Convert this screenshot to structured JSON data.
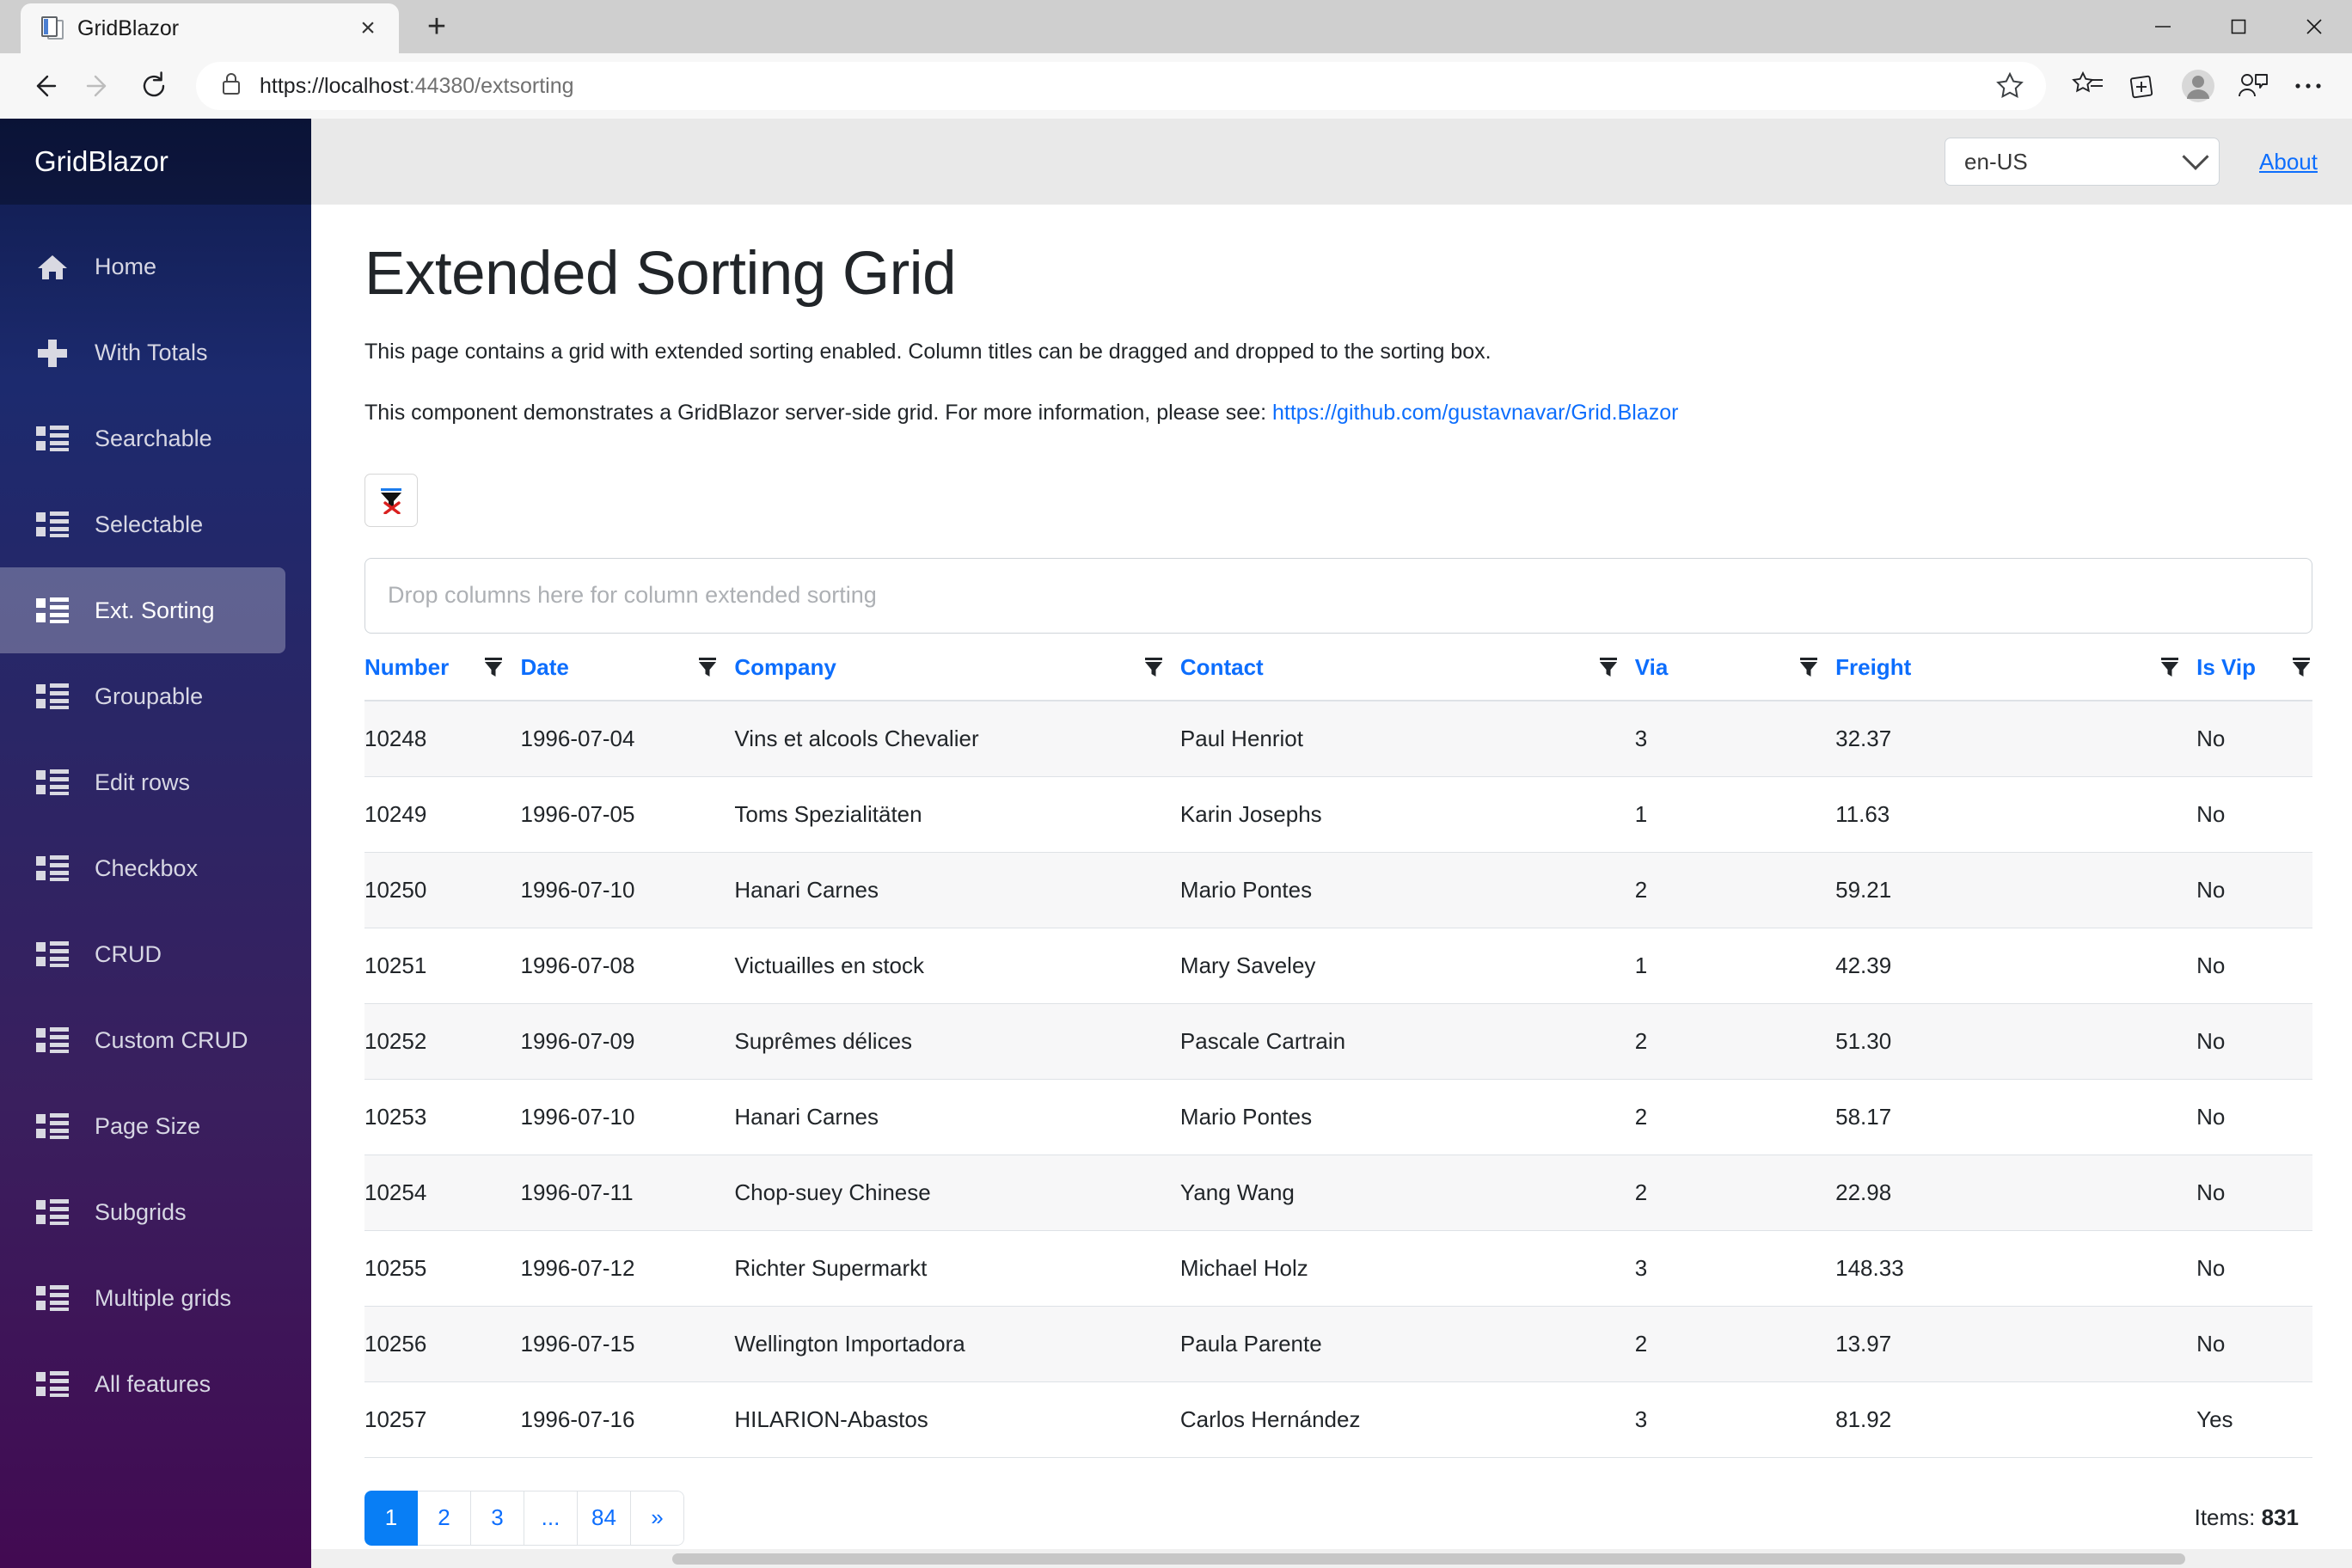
{
  "browser": {
    "tab": {
      "title": "GridBlazor",
      "favicon": "document-icon",
      "close": "×"
    },
    "new_tab": "+",
    "window_controls": {
      "minimize": "—",
      "maximize": "❐",
      "close": "✕"
    },
    "nav": {
      "back": "←",
      "forward": "→",
      "reload": "↻"
    },
    "url_scheme": "https://localhost",
    "url_rest": ":44380/extsorting",
    "url_full": "https://localhost:44380/extsorting",
    "icons": {
      "lock": "lock-icon",
      "star": "favorite-star-icon",
      "favorites": "favorites-collections-icon",
      "collections": "collections-icon",
      "profile": "profile-avatar-icon",
      "share": "share-feedback-icon",
      "settings": "more-options-icon"
    }
  },
  "sidebar": {
    "brand": "GridBlazor",
    "items": [
      {
        "label": "Home",
        "icon": "home-icon",
        "active": false
      },
      {
        "label": "With Totals",
        "icon": "plus-icon",
        "active": false
      },
      {
        "label": "Searchable",
        "icon": "list-icon",
        "active": false
      },
      {
        "label": "Selectable",
        "icon": "list-icon",
        "active": false
      },
      {
        "label": "Ext. Sorting",
        "icon": "list-icon",
        "active": true
      },
      {
        "label": "Groupable",
        "icon": "list-icon",
        "active": false
      },
      {
        "label": "Edit rows",
        "icon": "list-icon",
        "active": false
      },
      {
        "label": "Checkbox",
        "icon": "list-icon",
        "active": false
      },
      {
        "label": "CRUD",
        "icon": "list-icon",
        "active": false
      },
      {
        "label": "Custom CRUD",
        "icon": "list-icon",
        "active": false
      },
      {
        "label": "Page Size",
        "icon": "list-icon",
        "active": false
      },
      {
        "label": "Subgrids",
        "icon": "list-icon",
        "active": false
      },
      {
        "label": "Multiple grids",
        "icon": "list-icon",
        "active": false
      },
      {
        "label": "All features",
        "icon": "list-icon",
        "active": false
      }
    ]
  },
  "topbar": {
    "culture_value": "en-US",
    "culture_options": [
      "en-US"
    ],
    "about_label": "About"
  },
  "main": {
    "title": "Extended Sorting Grid",
    "description": "This page contains a grid with extended sorting enabled. Column titles can be dragged and dropped to the sorting box.",
    "description2_prefix": "This component demonstrates a GridBlazor server-side grid. For more information, please see: ",
    "description2_link": "https://github.com/gustavnavar/Grid.Blazor",
    "filter_button_icon": "clear-filter-funnel-icon",
    "dropzone_placeholder": "Drop columns here for column extended sorting"
  },
  "grid": {
    "columns": [
      {
        "label": "Number",
        "filter": "filter-funnel-icon"
      },
      {
        "label": "Date",
        "filter": "filter-funnel-icon"
      },
      {
        "label": "Company",
        "filter": "filter-funnel-icon"
      },
      {
        "label": "Contact",
        "filter": "filter-funnel-icon"
      },
      {
        "label": "Via",
        "filter": "filter-funnel-icon"
      },
      {
        "label": "Freight",
        "filter": "filter-funnel-icon"
      },
      {
        "label": "Is Vip",
        "filter": "filter-funnel-icon"
      }
    ],
    "rows": [
      {
        "number": "10248",
        "date": "1996-07-04",
        "company": "Vins et alcools Chevalier",
        "contact": "Paul Henriot",
        "via": "3",
        "freight": "32.37",
        "is_vip": "No"
      },
      {
        "number": "10249",
        "date": "1996-07-05",
        "company": "Toms Spezialitäten",
        "contact": "Karin Josephs",
        "via": "1",
        "freight": "11.63",
        "is_vip": "No"
      },
      {
        "number": "10250",
        "date": "1996-07-10",
        "company": "Hanari Carnes",
        "contact": "Mario Pontes",
        "via": "2",
        "freight": "59.21",
        "is_vip": "No"
      },
      {
        "number": "10251",
        "date": "1996-07-08",
        "company": "Victuailles en stock",
        "contact": "Mary Saveley",
        "via": "1",
        "freight": "42.39",
        "is_vip": "No"
      },
      {
        "number": "10252",
        "date": "1996-07-09",
        "company": "Suprêmes délices",
        "contact": "Pascale Cartrain",
        "via": "2",
        "freight": "51.30",
        "is_vip": "No"
      },
      {
        "number": "10253",
        "date": "1996-07-10",
        "company": "Hanari Carnes",
        "contact": "Mario Pontes",
        "via": "2",
        "freight": "58.17",
        "is_vip": "No"
      },
      {
        "number": "10254",
        "date": "1996-07-11",
        "company": "Chop-suey Chinese",
        "contact": "Yang Wang",
        "via": "2",
        "freight": "22.98",
        "is_vip": "No"
      },
      {
        "number": "10255",
        "date": "1996-07-12",
        "company": "Richter Supermarkt",
        "contact": "Michael Holz",
        "via": "3",
        "freight": "148.33",
        "is_vip": "No"
      },
      {
        "number": "10256",
        "date": "1996-07-15",
        "company": "Wellington Importadora",
        "contact": "Paula Parente",
        "via": "2",
        "freight": "13.97",
        "is_vip": "No"
      },
      {
        "number": "10257",
        "date": "1996-07-16",
        "company": "HILARION-Abastos",
        "contact": "Carlos Hernández",
        "via": "3",
        "freight": "81.92",
        "is_vip": "Yes"
      }
    ],
    "pager": {
      "pages": [
        "1",
        "2",
        "3",
        "...",
        "84",
        "»"
      ],
      "active_index": 0,
      "items_label": "Items: ",
      "items_count": "831"
    }
  },
  "colors": {
    "accent_blue": "#0d6efd",
    "active_page": "#087ef5",
    "sidebar_top": "#0f1b4c",
    "sidebar_bottom": "#420a52",
    "topbar_bg": "#e9e9e9",
    "row_stripe": "#f7f7f8"
  }
}
